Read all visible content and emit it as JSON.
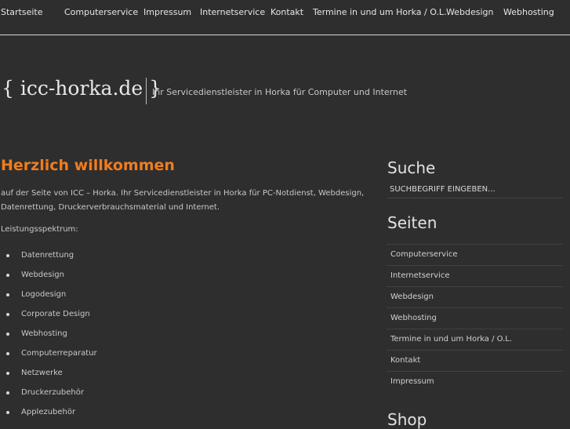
{
  "nav": {
    "items": [
      "Startseite",
      "Computerservice",
      "Impressum",
      "Internetservice",
      "Kontakt",
      "Termine in und um Horka / O.L.",
      "Webdesign",
      "Webhosting"
    ]
  },
  "header": {
    "logo": "{ icc-horka.de }",
    "tagline": "Ihr Servicedienstleister in Horka für Computer und Internet"
  },
  "main": {
    "title": "Herzlich willkommen",
    "intro": "auf der Seite von ICC – Horka. Ihr Servicedienstleister in Horka für PC-Notdienst, Webdesign, Datenrettung, Druckerverbrauchsmaterial und Internet.",
    "leistungen_label": "Leistungsspektrum:",
    "services": [
      "Datenrettung",
      "Webdesign",
      "Logodesign",
      "Corporate Design",
      "Webhosting",
      "Computerreparatur",
      "Netzwerke",
      "Druckerzubehör",
      "Applezubehör"
    ]
  },
  "sidebar": {
    "search_title": "Suche",
    "search_placeholder": "SUCHBEGRIFF EINGEBEN...",
    "pages_title": "Seiten",
    "pages": [
      "Computerservice",
      "Internetservice",
      "Webdesign",
      "Webhosting",
      "Termine in und um Horka / O.L.",
      "Kontakt",
      "Impressum"
    ],
    "shop_title": "Shop"
  },
  "colors": {
    "accent": "#f07d1e",
    "background": "#2e2e2e"
  }
}
